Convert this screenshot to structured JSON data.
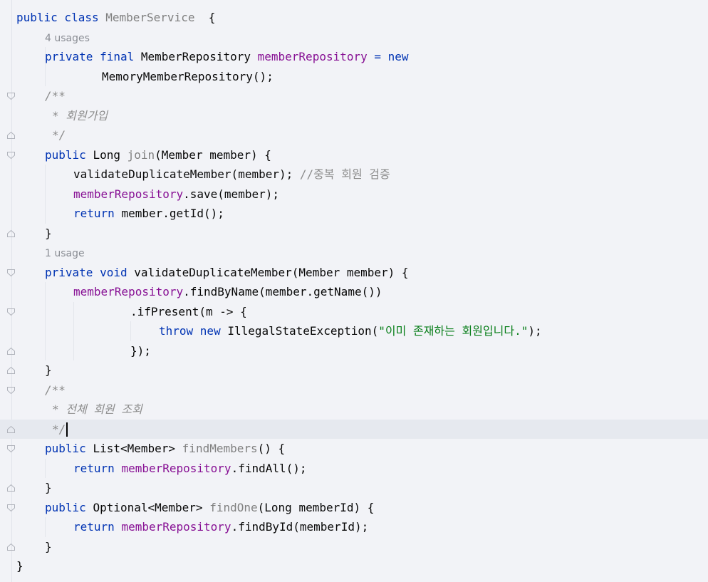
{
  "editor": {
    "language": "Java",
    "lines": [
      {
        "indent": 0,
        "tokens": [
          [
            "kw",
            "public class "
          ],
          [
            "unused",
            "MemberService"
          ],
          [
            "",
            "  {"
          ]
        ]
      },
      {
        "indent": 4,
        "hint": "4 usages"
      },
      {
        "indent": 4,
        "tokens": [
          [
            "kw",
            "private final "
          ],
          [
            "",
            "MemberRepository "
          ],
          [
            "field",
            "memberRepository"
          ],
          [
            "",
            ""
          ],
          [
            "kw",
            " = new"
          ]
        ]
      },
      {
        "indent": 12,
        "tokens": [
          [
            "",
            "MemoryMemberRepository();"
          ]
        ]
      },
      {
        "indent": 4,
        "fold": "open",
        "tokens": [
          [
            "cm-i",
            "/**"
          ]
        ]
      },
      {
        "indent": 5,
        "tokens": [
          [
            "cm-i",
            "* 회원가입"
          ]
        ]
      },
      {
        "indent": 5,
        "fold": "close",
        "tokens": [
          [
            "cm-i",
            "*/"
          ]
        ]
      },
      {
        "indent": 4,
        "fold": "open",
        "tokens": [
          [
            "kw",
            "public "
          ],
          [
            "",
            "Long "
          ],
          [
            "unused",
            "join"
          ],
          [
            "",
            "(Member member) {"
          ]
        ]
      },
      {
        "indent": 8,
        "tokens": [
          [
            "",
            "validateDuplicateMember(member); "
          ],
          [
            "cm",
            "//중복 회원 검증"
          ]
        ]
      },
      {
        "indent": 8,
        "tokens": [
          [
            "field",
            "memberRepository"
          ],
          [
            "",
            ".save(member);"
          ]
        ]
      },
      {
        "indent": 8,
        "tokens": [
          [
            "kw",
            "return "
          ],
          [
            "",
            "member.getId();"
          ]
        ]
      },
      {
        "indent": 4,
        "fold": "close",
        "tokens": [
          [
            "",
            "}"
          ]
        ]
      },
      {
        "indent": 4,
        "hint": "1 usage"
      },
      {
        "indent": 4,
        "fold": "open",
        "tokens": [
          [
            "kw",
            "private void "
          ],
          [
            "",
            "validateDuplicateMember(Member member) {"
          ]
        ]
      },
      {
        "indent": 8,
        "tokens": [
          [
            "field",
            "memberRepository"
          ],
          [
            "",
            ".findByName(member.getName())"
          ]
        ]
      },
      {
        "indent": 16,
        "fold": "open",
        "tokens": [
          [
            "",
            ".ifPresent(m -> {"
          ]
        ]
      },
      {
        "indent": 20,
        "tokens": [
          [
            "kw",
            "throw new "
          ],
          [
            "",
            "IllegalStateException("
          ],
          [
            "str",
            "\"이미 존재하는 회원입니다.\""
          ],
          [
            "",
            ");"
          ]
        ]
      },
      {
        "indent": 16,
        "fold": "close",
        "tokens": [
          [
            "",
            "});"
          ]
        ]
      },
      {
        "indent": 4,
        "fold": "close",
        "tokens": [
          [
            "",
            "}"
          ]
        ]
      },
      {
        "indent": 4,
        "fold": "open",
        "tokens": [
          [
            "cm-i",
            "/**"
          ]
        ]
      },
      {
        "indent": 5,
        "tokens": [
          [
            "cm-i",
            "* 전체 회원 조회"
          ]
        ]
      },
      {
        "indent": 5,
        "fold": "close",
        "current": true,
        "caret": true,
        "tokens": [
          [
            "cm-i",
            "*/"
          ]
        ]
      },
      {
        "indent": 4,
        "fold": "open",
        "tokens": [
          [
            "kw",
            "public "
          ],
          [
            "",
            "List<Member> "
          ],
          [
            "unused",
            "findMembers"
          ],
          [
            "",
            "() {"
          ]
        ]
      },
      {
        "indent": 8,
        "tokens": [
          [
            "kw",
            "return "
          ],
          [
            "field",
            "memberRepository"
          ],
          [
            "",
            ".findAll();"
          ]
        ]
      },
      {
        "indent": 4,
        "fold": "close",
        "tokens": [
          [
            "",
            "}"
          ]
        ]
      },
      {
        "indent": 4,
        "fold": "open",
        "tokens": [
          [
            "kw",
            "public "
          ],
          [
            "",
            "Optional<Member> "
          ],
          [
            "unused",
            "findOne"
          ],
          [
            "",
            "(Long memberId) {"
          ]
        ]
      },
      {
        "indent": 8,
        "tokens": [
          [
            "kw",
            "return "
          ],
          [
            "field",
            "memberRepository"
          ],
          [
            "",
            ".findById(memberId);"
          ]
        ]
      },
      {
        "indent": 4,
        "fold": "close",
        "tokens": [
          [
            "",
            "}"
          ]
        ]
      },
      {
        "indent": 0,
        "tokens": [
          [
            "",
            "}"
          ]
        ]
      }
    ]
  }
}
